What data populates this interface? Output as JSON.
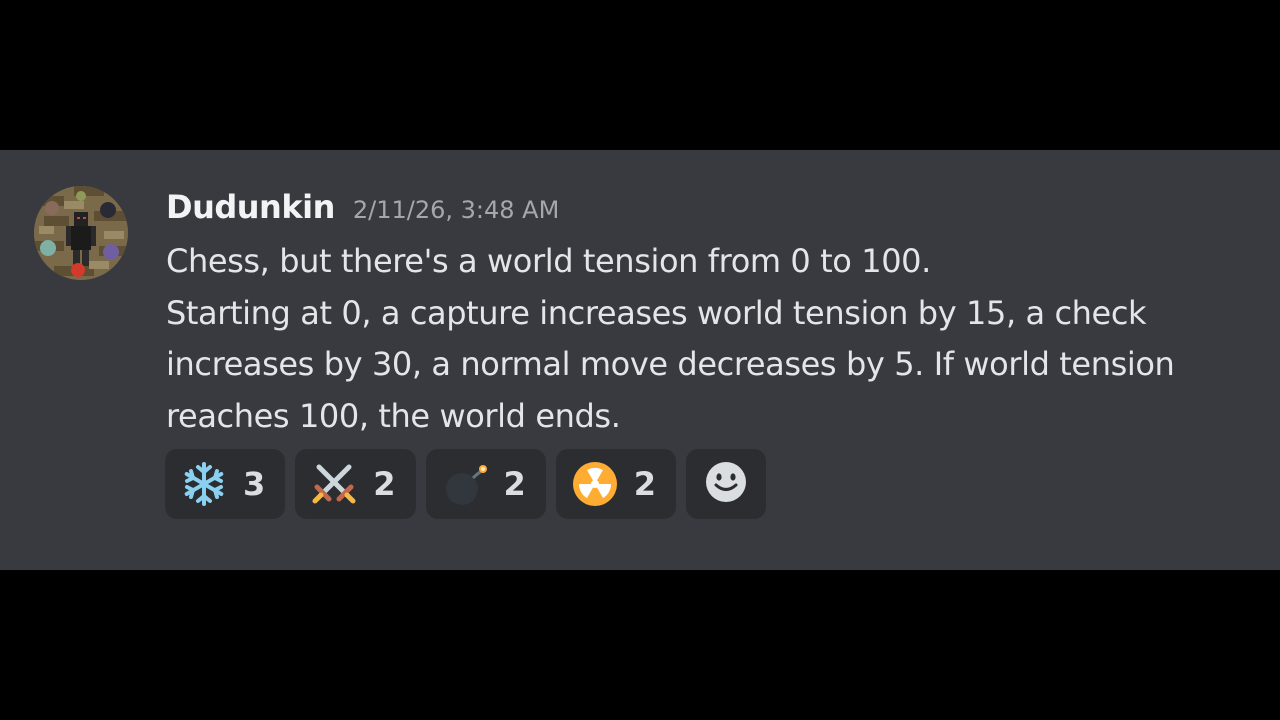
{
  "message": {
    "author": "Dudunkin",
    "timestamp": "2/11/26, 3:48 AM",
    "lines": [
      "Chess, but there's a world tension from 0 to 100.",
      "Starting at 0, a capture increases world tension by 15, a check",
      "increases by 30, a normal move decreases by 5. If world tension",
      "reaches 100, the world ends."
    ]
  },
  "reactions": [
    {
      "icon": "snowflake-icon",
      "count": "3"
    },
    {
      "icon": "crossed-swords-icon",
      "count": "2"
    },
    {
      "icon": "bomb-icon",
      "count": "2"
    },
    {
      "icon": "radioactive-icon",
      "count": "2"
    }
  ],
  "add_reaction": {
    "icon": "smiley-add-reaction-icon"
  },
  "colors": {
    "background": "#000000",
    "panel": "#383a40",
    "reaction_bg": "#2b2d31",
    "username": "#f2f3f5",
    "timestamp": "#a4a7ad",
    "text": "#e4e5e8"
  }
}
